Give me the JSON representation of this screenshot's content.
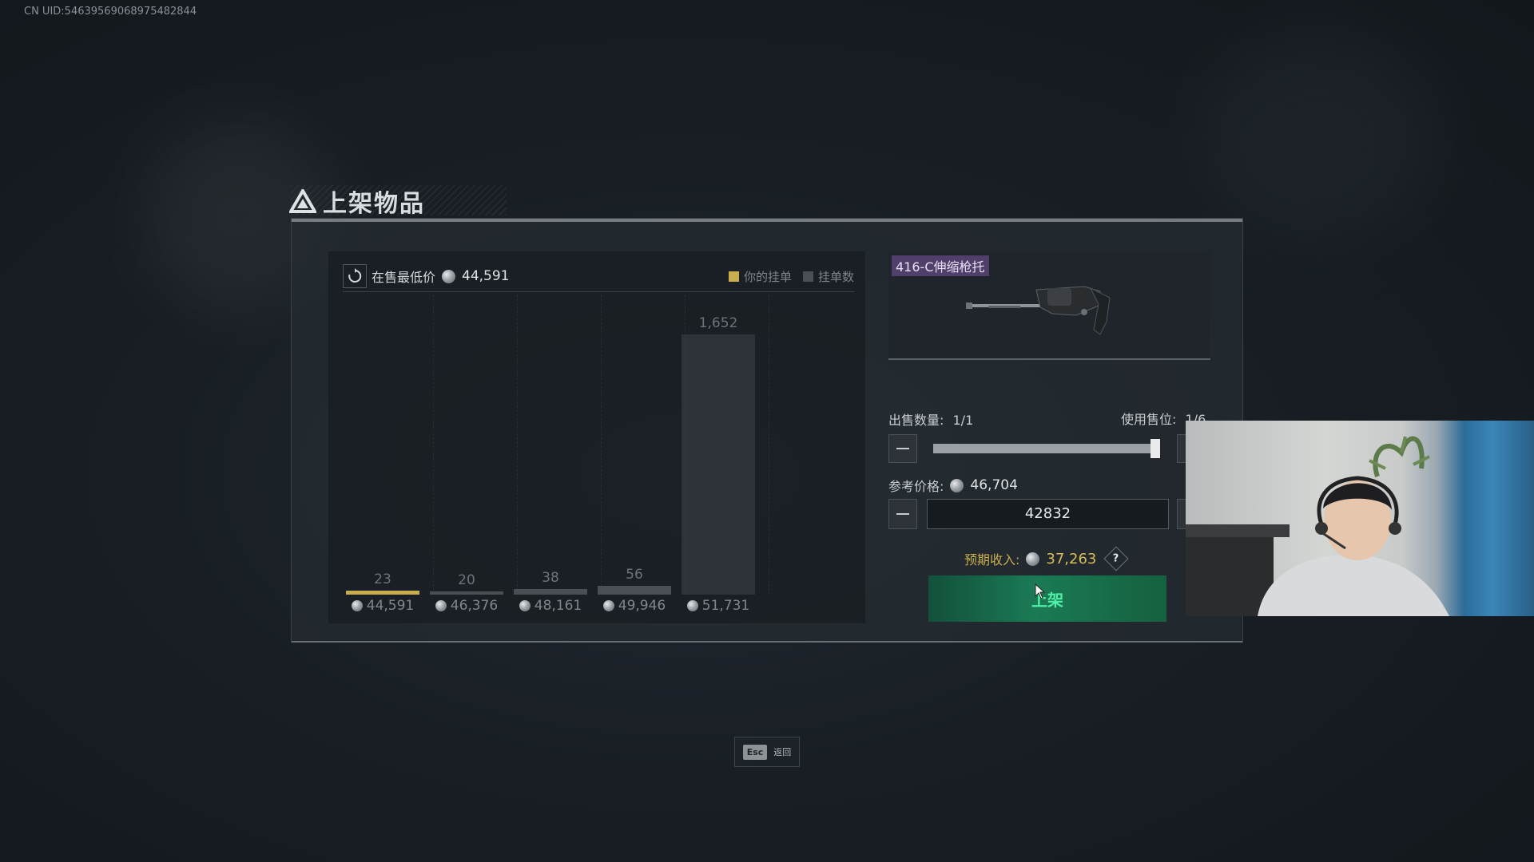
{
  "uid_text": "CN UID:5463956906897548284​4",
  "dialog": {
    "title": "上架物品"
  },
  "chart_header": {
    "lowest_price_label": "在售最低价",
    "lowest_price_value": "44,591",
    "legend_mine": "你的挂单",
    "legend_count": "挂单数"
  },
  "colors": {
    "mine": "#c8ad4e",
    "listing": "#4a4f55",
    "confirm_text": "#4ff0a6",
    "item_tag": "#4f3f6a"
  },
  "chart_data": {
    "type": "bar",
    "categories": [
      "44,591",
      "46,376",
      "48,161",
      "49,946",
      "51,731"
    ],
    "values": [
      23,
      20,
      38,
      56,
      1652
    ],
    "mine_index": 0
  },
  "item": {
    "name": "416-C伸缩枪托",
    "icon": "stock-icon"
  },
  "sell": {
    "qty_label": "出售数量:",
    "qty_value": "1/1",
    "slot_label": "使用售位:",
    "slot_value": "1/6",
    "slider_fraction": 1.0,
    "ref_label": "参考价格:",
    "ref_value": "46,704",
    "price_input": "42832",
    "income_label": "预期收入:",
    "income_value": "37,263",
    "help_symbol": "?",
    "confirm_label": "上架"
  },
  "esc_hint": {
    "key": "Esc",
    "label": "返回"
  }
}
